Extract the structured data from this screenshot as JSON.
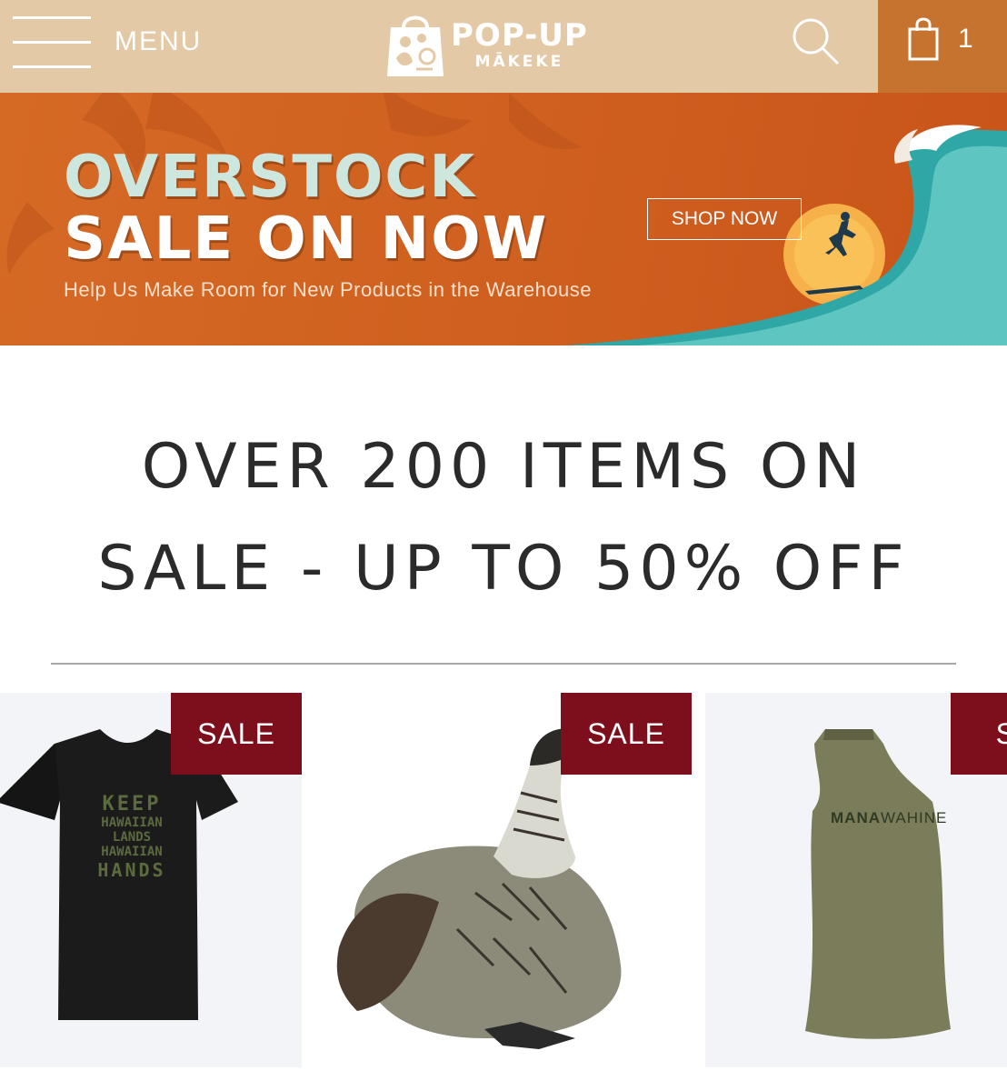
{
  "header": {
    "menu_label": "MENU",
    "logo_title": "POP-UP",
    "logo_subtitle": "MĀKEKE",
    "cart_count": "1",
    "bg_color": "#e4c9a6",
    "cart_bg_color": "#c6732f"
  },
  "banner": {
    "title_line1": "OVERSTOCK",
    "title_line2": "SALE ON NOW",
    "subtitle": "Help Us Make Room for New Products in the Warehouse",
    "button_label": "SHOP NOW",
    "bg_color": "#d0601f"
  },
  "headline": {
    "line1": "OVER 200 ITEMS ON",
    "line2": "SALE - UP TO 50% OFF"
  },
  "products": [
    {
      "badge": "SALE",
      "name": "keep-hawaiian-lands-tshirt",
      "shirt_text": [
        "KEEP",
        "HAWAIIAN",
        "LANDS",
        "HAWAIIAN",
        "HANDS"
      ]
    },
    {
      "badge": "SALE",
      "name": "nene-plush"
    },
    {
      "badge": "SA",
      "name": "mana-wahine-tank",
      "shirt_text": [
        "MANA",
        "WAHINE"
      ]
    }
  ],
  "colors": {
    "sale_badge": "#7d0f1d"
  }
}
